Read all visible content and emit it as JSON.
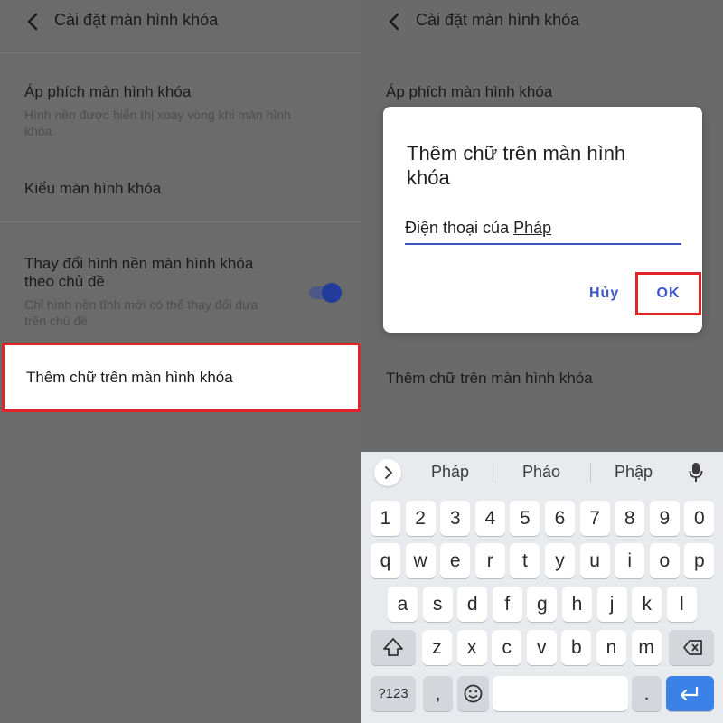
{
  "left_screen": {
    "title": "Cài đặt màn hình khóa",
    "items": [
      {
        "title": "Áp phích màn hình khóa",
        "subtitle_line1": "Hình nền được hiển thị xoay vòng khi màn hình",
        "subtitle_line2": "khóa"
      },
      {
        "title": "Kiểu màn hình khóa"
      },
      {
        "title_line1": "Thay đổi hình nền màn hình khóa",
        "title_line2": "theo chủ đề",
        "subtitle_line1": "Chỉ hình nền tĩnh mới có thể thay đổi dựa",
        "subtitle_line2": "trên chủ đề"
      },
      {
        "title": "Thêm chữ trên màn hình khóa"
      }
    ],
    "toggle_on": true
  },
  "right_screen": {
    "title": "Cài đặt màn hình khóa",
    "item_top": "Áp phích màn hình khóa",
    "item_bottom": "Thêm chữ trên màn hình khóa",
    "dialog": {
      "title_line1": "Thêm chữ trên màn hình",
      "title_line2": "khóa",
      "input_prefix": "Điện thoại của ",
      "input_underlined": "Pháp",
      "cancel_label": "Hủy",
      "ok_label": "OK"
    },
    "keyboard": {
      "suggestions": [
        "Pháp",
        "Pháo",
        "Phập"
      ],
      "row_numbers": [
        "1",
        "2",
        "3",
        "4",
        "5",
        "6",
        "7",
        "8",
        "9",
        "0"
      ],
      "row_1": [
        "q",
        "w",
        "e",
        "r",
        "t",
        "y",
        "u",
        "i",
        "o",
        "p"
      ],
      "row_2": [
        "a",
        "s",
        "d",
        "f",
        "g",
        "h",
        "j",
        "k",
        "l"
      ],
      "row_3": [
        "z",
        "x",
        "c",
        "v",
        "b",
        "n",
        "m"
      ],
      "symbols_label": "?123",
      "comma_label": ",",
      "period_label": "."
    }
  },
  "colors": {
    "highlight_border": "#e2242a",
    "accent": "#3c57c6",
    "enter_key": "#3a82e8"
  }
}
